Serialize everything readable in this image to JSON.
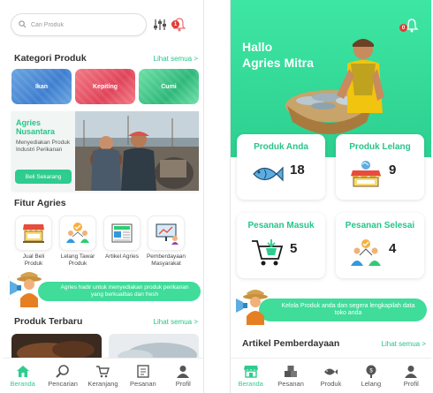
{
  "left_screen": {
    "search": {
      "placeholder": "Cari Produk"
    },
    "notification_badge": "1",
    "categories": {
      "title": "Kategori Produk",
      "see_all": "Lihat semua >",
      "items": [
        {
          "label": "Ikan",
          "color": "#4a8bd6"
        },
        {
          "label": "Kepiting",
          "color": "#e84d62"
        },
        {
          "label": "Cumi",
          "color": "#3cc98b"
        }
      ]
    },
    "banner": {
      "title": "Agries Nusantara",
      "description": "Menyediakan Produk Industri Perikanan",
      "cta": "Beli Sekarang"
    },
    "features": {
      "title": "Fitur Agries",
      "items": [
        {
          "label": "Jual Beli Produk",
          "icon": "stall-icon"
        },
        {
          "label": "Lelang Tawar Produk",
          "icon": "auction-people-icon"
        },
        {
          "label": "Artikel Agries",
          "icon": "article-icon"
        },
        {
          "label": "Pemberdayaan Masyarakat",
          "icon": "presentation-icon"
        }
      ]
    },
    "promo": "Agries hadir untuk menyediakan produk perikanan yang berkualitas dan fresh",
    "new_products": {
      "title": "Produk Terbaru",
      "see_all": "Lihat semua >"
    },
    "nav": [
      {
        "label": "Beranda",
        "icon": "home-icon",
        "active": true
      },
      {
        "label": "Pencarian",
        "icon": "search-icon",
        "active": false
      },
      {
        "label": "Keranjang",
        "icon": "cart-icon",
        "active": false
      },
      {
        "label": "Pesanan",
        "icon": "orders-icon",
        "active": false
      },
      {
        "label": "Profil",
        "icon": "profile-icon",
        "active": false
      }
    ]
  },
  "right_screen": {
    "greeting_line1": "Hallo",
    "greeting_line2": "Agries Mitra",
    "notification_badge": "0",
    "stats": [
      {
        "title": "Produk Anda",
        "count": "18",
        "icon": "fish-icon"
      },
      {
        "title": "Produk Lelang",
        "count": "9",
        "icon": "auction-stall-icon"
      },
      {
        "title": "Pesanan Masuk",
        "count": "5",
        "icon": "cart-icon"
      },
      {
        "title": "Pesanan Selesai",
        "count": "4",
        "icon": "done-people-icon"
      }
    ],
    "promo": "Kelola Produk anda dan segera lengkapilah data toko anda",
    "articles": {
      "title": "Artikel Pemberdayaan",
      "see_all": "Lihat semua >"
    },
    "nav": [
      {
        "label": "Beranda",
        "icon": "store-icon",
        "active": true
      },
      {
        "label": "Pesanan",
        "icon": "boxes-icon",
        "active": false
      },
      {
        "label": "Produk",
        "icon": "fish-product-icon",
        "active": false
      },
      {
        "label": "Lelang",
        "icon": "auction-icon",
        "active": false
      },
      {
        "label": "Profil",
        "icon": "profile-icon",
        "active": false
      }
    ]
  },
  "colors": {
    "accent": "#2ecc8e",
    "accent_text": "#27c48a",
    "badge": "#e53935"
  }
}
